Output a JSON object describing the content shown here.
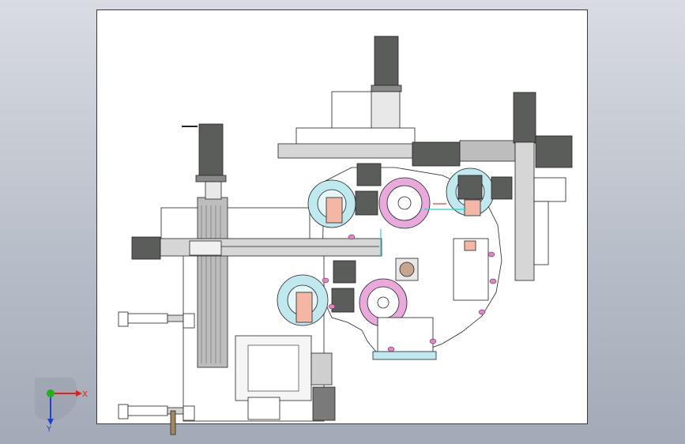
{
  "viewport": {
    "background_top": "#d9dce2",
    "background_bottom": "#a3aab7",
    "sheet_color": "#ffffff"
  },
  "triad": {
    "x_label": "X",
    "y_label": "Y",
    "x_color": "#e02020",
    "y_color": "#2040d0",
    "origin_color": "#20b020"
  },
  "palette": {
    "motor": "#5a5d5a",
    "frame": "#9a9a9a",
    "roll_outer": "#bfe9ee",
    "roll_inner_pink": "#f4b7a6",
    "hub_magenta": "#e9a9dc",
    "hole_pink": "#e680c8",
    "accent_cyan": "#37c7d0"
  }
}
